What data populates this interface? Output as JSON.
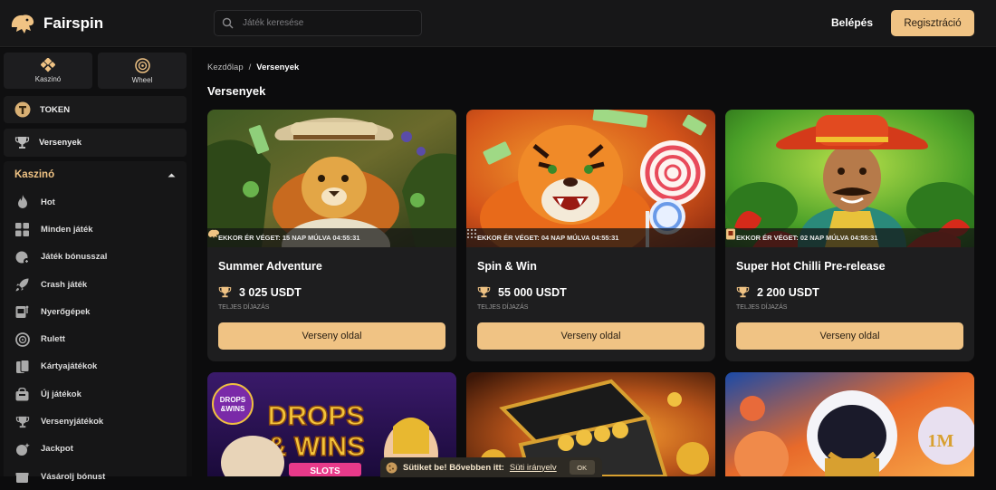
{
  "header": {
    "logo_text": "Fairspin",
    "search_placeholder": "Játék keresése",
    "login_label": "Belépés",
    "register_label": "Regisztráció"
  },
  "sidebar": {
    "top_tabs": [
      {
        "label": "Kaszinó",
        "icon": "casino-icon"
      },
      {
        "label": "Wheel",
        "icon": "wheel-icon"
      }
    ],
    "token_label": "TOKEN",
    "tournaments_label": "Versenyek",
    "casino_section_label": "Kaszinó",
    "casino_items": [
      {
        "label": "Hot",
        "icon": "flame-icon"
      },
      {
        "label": "Minden játék",
        "icon": "grid-icon"
      },
      {
        "label": "Játék bónusszal",
        "icon": "bonus-icon"
      },
      {
        "label": "Crash játék",
        "icon": "rocket-icon"
      },
      {
        "label": "Nyerőgépek",
        "icon": "slot-icon"
      },
      {
        "label": "Rulett",
        "icon": "roulette-icon"
      },
      {
        "label": "Kártyajátékok",
        "icon": "cards-icon"
      },
      {
        "label": "Új játékok",
        "icon": "new-games-icon"
      },
      {
        "label": "Versenyjátékok",
        "icon": "trophy-icon"
      },
      {
        "label": "Jackpot",
        "icon": "jackpot-icon"
      },
      {
        "label": "Vásárolj bónust",
        "icon": "buy-bonus-icon"
      }
    ]
  },
  "main": {
    "breadcrumb": {
      "home": "Kezdőlap",
      "separator": "/",
      "current": "Versenyek"
    },
    "title": "Versenyek",
    "cards": [
      {
        "timer": "EKKOR ÉR VÉGET: 15 NAP MÚLVA 04:55:31",
        "title": "Summer Adventure",
        "amount": "3 025 USDT",
        "prize_label": "TELJES DÍJAZÁS",
        "button": "Verseny oldal"
      },
      {
        "timer": "EKKOR ÉR VÉGET: 04 NAP MÚLVA 04:55:31",
        "title": "Spin & Win",
        "amount": "55 000 USDT",
        "prize_label": "TELJES DÍJAZÁS",
        "button": "Verseny oldal"
      },
      {
        "timer": "EKKOR ÉR VÉGET: 02 NAP MÚLVA 04:55:31",
        "title": "Super Hot Chilli Pre-release",
        "amount": "2 200 USDT",
        "prize_label": "TELJES DÍJAZÁS",
        "button": "Verseny oldal"
      }
    ],
    "row2_banners": {
      "drops_badge_top": "DROPS",
      "drops_badge_bottom": "&WINS",
      "drops_title_1": "DROPS",
      "drops_title_2": "& WINS",
      "slots": "SLOTS",
      "logo_1m": "1M"
    }
  },
  "cookie": {
    "text": "Sütiket be! Bővebben itt:",
    "link": "Süti irányelv",
    "ok": "OK"
  },
  "colors": {
    "accent": "#f0c384",
    "background": "#0c0c0d",
    "card": "#1e1e1f"
  }
}
